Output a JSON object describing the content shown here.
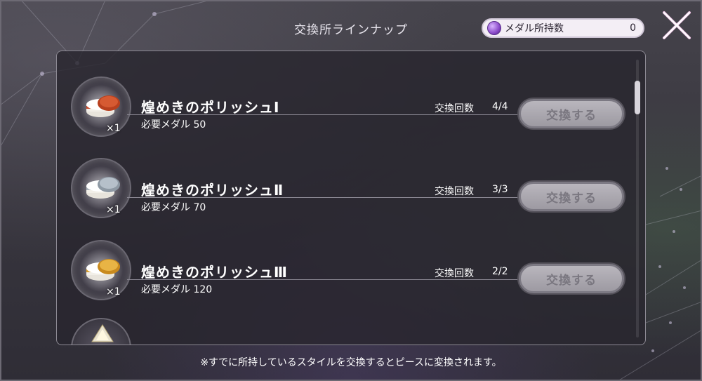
{
  "header": {
    "title": "交換所ラインナップ",
    "medal_label": "メダル所持数",
    "medal_count": "0"
  },
  "items": [
    {
      "name": "煌めきのポリッシュⅠ",
      "quantity": "×1",
      "required": "必要メダル 50",
      "count_label": "交換回数",
      "count_value": "4/4",
      "button_label": "交換する",
      "lid_color": "#b8401e",
      "icon": "polish-jar-red-icon"
    },
    {
      "name": "煌めきのポリッシュⅡ",
      "quantity": "×1",
      "required": "必要メダル 70",
      "count_label": "交換回数",
      "count_value": "3/3",
      "button_label": "交換する",
      "lid_color": "#9aa5b0",
      "icon": "polish-jar-silver-icon"
    },
    {
      "name": "煌めきのポリッシュⅢ",
      "quantity": "×1",
      "required": "必要メダル 120",
      "count_label": "交換回数",
      "count_value": "2/2",
      "button_label": "交換する",
      "lid_color": "#d49a2a",
      "icon": "polish-jar-gold-icon"
    }
  ],
  "footnote": "※すでに所持しているスタイルを交換するとピースに変換されます。",
  "colors": {
    "accent": "#8a49c9",
    "button_disabled": "#a9a6ae"
  }
}
